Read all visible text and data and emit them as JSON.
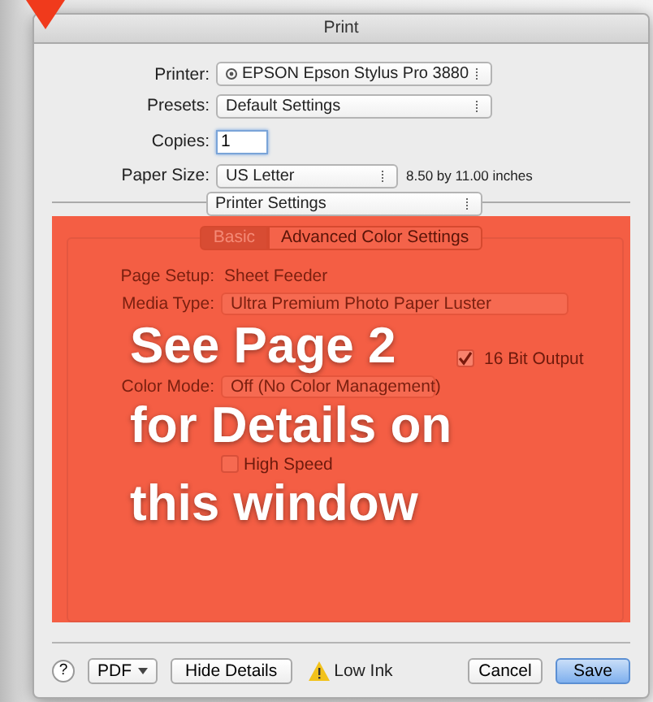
{
  "window": {
    "title": "Print"
  },
  "printer": {
    "label": "Printer:",
    "value": "EPSON Epson Stylus Pro 3880"
  },
  "presets": {
    "label": "Presets:",
    "value": "Default Settings"
  },
  "copies": {
    "label": "Copies:",
    "value": "1"
  },
  "paper_size": {
    "label": "Paper Size:",
    "value": "US Letter",
    "dimensions": "8.50 by 11.00 inches"
  },
  "panel_menu": {
    "value": "Printer Settings"
  },
  "tabs": [
    {
      "label": "Basic",
      "selected": true
    },
    {
      "label": "Advanced Color Settings",
      "selected": false
    }
  ],
  "page_setup": {
    "label": "Page Setup:",
    "value": "Sheet Feeder"
  },
  "media_type": {
    "label": "Media Type:",
    "value": "Ultra Premium Photo Paper Luster"
  },
  "bit_output": {
    "label": "16 Bit Output",
    "checked": true
  },
  "color_mode": {
    "label": "Color Mode:",
    "value": "Off (No Color Management)"
  },
  "options": [
    {
      "label": "High Speed",
      "checked": false
    }
  ],
  "overlay": {
    "lines": [
      "See Page 2",
      "for Details on",
      "this window"
    ]
  },
  "footer": {
    "help": "?",
    "warning": "Low Ink",
    "buttons": [
      {
        "kind": "menu",
        "label": "PDF"
      },
      {
        "kind": "plain",
        "label": "Hide Details"
      },
      {
        "kind": "plain",
        "label": "Cancel"
      },
      {
        "kind": "default",
        "label": "Save"
      }
    ]
  }
}
